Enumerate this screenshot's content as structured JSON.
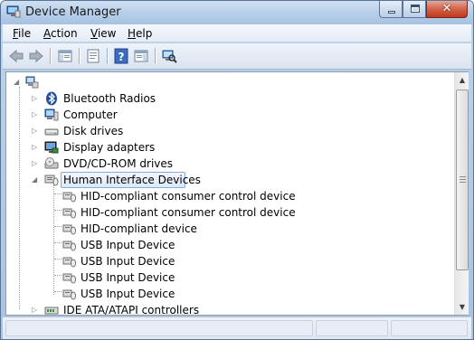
{
  "window": {
    "title": "Device Manager",
    "icon": "device-manager-icon",
    "controls": {
      "minimize": "minimize",
      "maximize": "maximize",
      "close": "✕"
    }
  },
  "menu": {
    "items": [
      {
        "accel": "F",
        "rest": "ile"
      },
      {
        "accel": "A",
        "rest": "ction"
      },
      {
        "accel": "V",
        "rest": "iew"
      },
      {
        "accel": "H",
        "rest": "elp"
      }
    ]
  },
  "toolbar": {
    "buttons": [
      "back-arrow-icon",
      "forward-arrow-icon",
      "show-hide-console-tree-icon",
      "properties-icon",
      "help-icon",
      "action-pane-icon",
      "scan-hardware-icon"
    ]
  },
  "tree": {
    "root_icon": "computer-network-icon",
    "categories": [
      {
        "label": "Bluetooth Radios",
        "icon": "bluetooth-icon",
        "expanded": false
      },
      {
        "label": "Computer",
        "icon": "computer-icon",
        "expanded": false
      },
      {
        "label": "Disk drives",
        "icon": "disk-drive-icon",
        "expanded": false
      },
      {
        "label": "Display adapters",
        "icon": "display-adapter-icon",
        "expanded": false
      },
      {
        "label": "DVD/CD-ROM drives",
        "icon": "dvd-drive-icon",
        "expanded": false
      },
      {
        "label": "Human Interface Devices",
        "icon": "hid-icon",
        "expanded": true,
        "selected": true,
        "children": [
          "HID-compliant consumer control device",
          "HID-compliant consumer control device",
          "HID-compliant device",
          "USB Input Device",
          "USB Input Device",
          "USB Input Device",
          "USB Input Device"
        ]
      },
      {
        "label": "IDE ATA/ATAPI controllers",
        "icon": "ide-controller-icon",
        "expanded": false
      }
    ]
  },
  "colors": {
    "selection_border": "#84acdd",
    "selection_fill": "#dde9f8",
    "bluetooth_blue": "#1f4f9e",
    "close_red": "#c0391c"
  }
}
